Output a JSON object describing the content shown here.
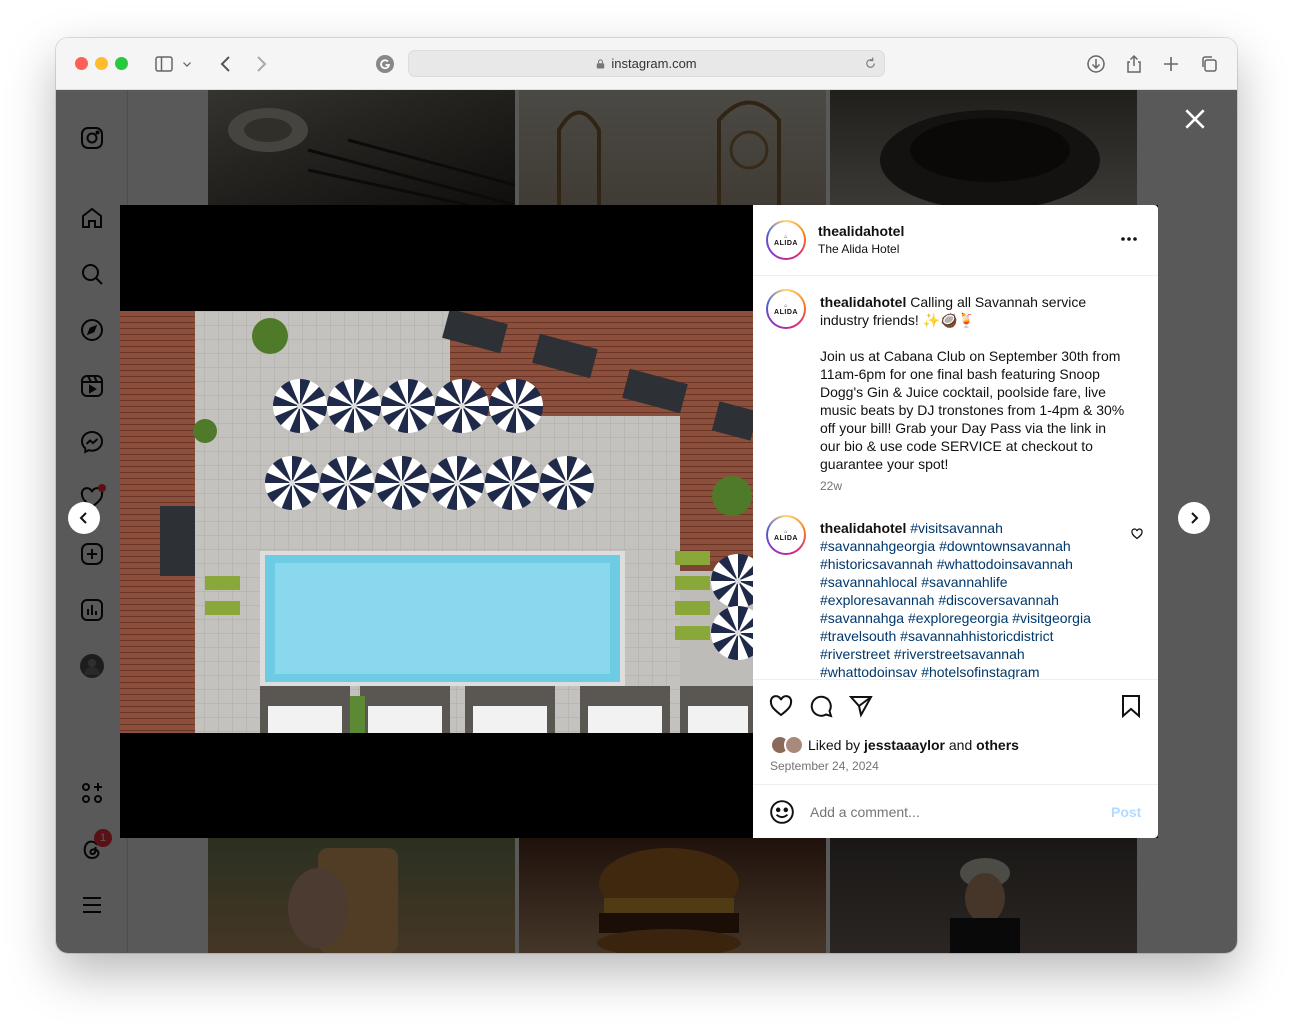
{
  "browser": {
    "url": "instagram.com"
  },
  "post": {
    "username": "thealidahotel",
    "location": "The Alida Hotel",
    "avatar_text": "ALIDA",
    "caption_username": "thealidahotel",
    "caption_line1": "Calling all Savannah service industry friends! ✨🥥🍹",
    "caption_body": "Join us at Cabana Club on September 30th from 11am-6pm for one final bash featuring Snoop Dogg's Gin & Juice cocktail, poolside fare, live music beats by DJ tronstones from 1-4pm & 30% off your bill! Grab your Day Pass via the link in our bio & use code SERVICE at checkout to guarantee your spot!",
    "caption_age": "22w",
    "comment_username": "thealidahotel",
    "hashtags": [
      "#visitsavannah",
      "#savannahgeorgia",
      "#downtownsavannah",
      "#historicsavannah",
      "#whattodoinsavannah",
      "#savannahlocal",
      "#savannahlife",
      "#exploresavannah",
      "#discoversavannah",
      "#savannahga",
      "#exploregeorgia",
      "#visitgeorgia",
      "#travelsouth",
      "#savannahhistoricdistrict",
      "#riverstreet",
      "#riverstreetsavannah",
      "#whattodoinsav",
      "#hotelsofinstagram"
    ],
    "liked_prefix": "Liked by",
    "liked_user": "jesstaaaylor",
    "liked_and": "and",
    "liked_others": "others",
    "date": "September 24, 2024",
    "comment_placeholder": "Add a comment...",
    "post_button": "Post"
  },
  "sidebar": {
    "notification_badge": "1"
  },
  "colors": {
    "link": "#00376b",
    "post_button_disabled": "#b3dbff",
    "badge": "#ff3040"
  }
}
